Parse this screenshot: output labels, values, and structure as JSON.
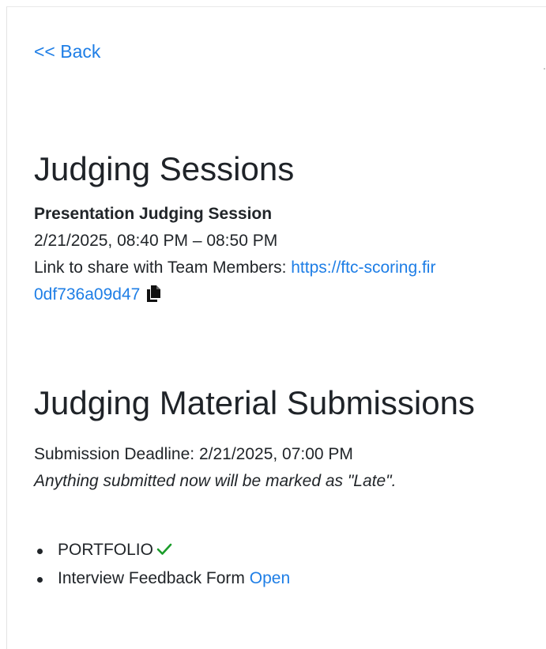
{
  "nav": {
    "back_label": "<< Back"
  },
  "sessions": {
    "heading": "Judging Sessions",
    "session_title": "Presentation Judging Session",
    "time_range": "2/21/2025, 08:40 PM – 08:50 PM",
    "share_prefix": "Link to share with Team Members: ",
    "share_link_visible": "https://ftc-scoring.fir",
    "share_link_continued": "0df736a09d47",
    "copy_icon": "copy-icon"
  },
  "submissions": {
    "heading": "Judging Material Submissions",
    "deadline": "Submission Deadline: 2/21/2025, 07:00 PM",
    "late_note": "Anything submitted now will be marked as \"Late\".",
    "items": [
      {
        "label": "PORTFOLIO",
        "status_icon": "check-icon"
      },
      {
        "label": "Interview Feedback Form ",
        "action_label": "Open"
      }
    ]
  },
  "colors": {
    "link": "#1e7ee6",
    "check": "#1a9c2a",
    "text": "#212529"
  }
}
